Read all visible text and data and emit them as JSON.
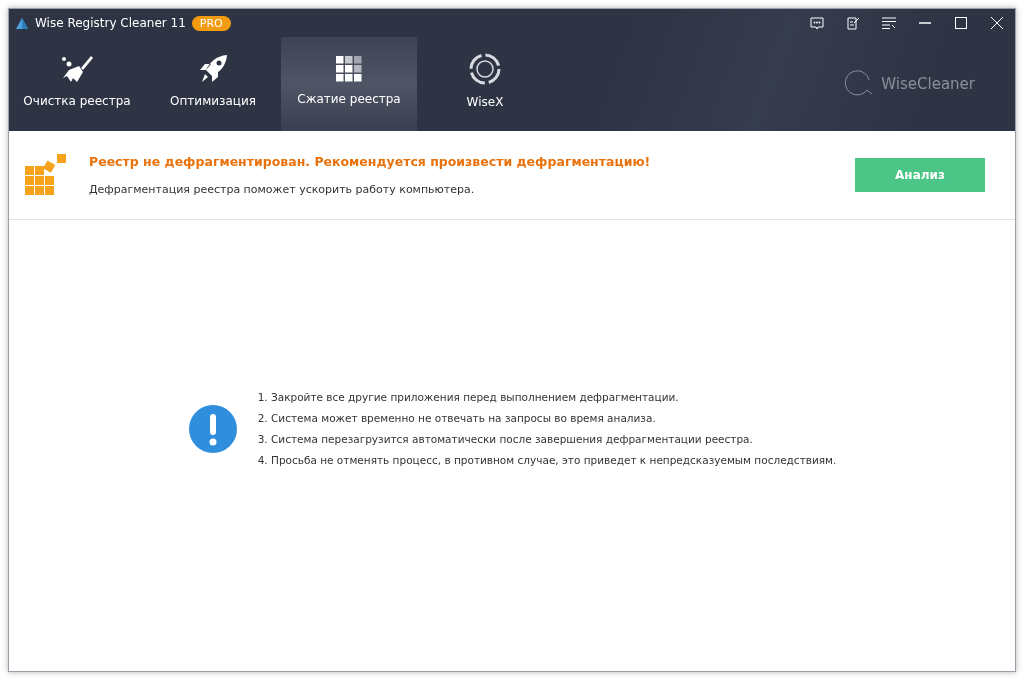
{
  "window": {
    "title": "Wise Registry Cleaner 11",
    "badge": "PRO"
  },
  "tabs": [
    {
      "label": "Очистка реестра",
      "selected": false
    },
    {
      "label": "Оптимизация",
      "selected": false
    },
    {
      "label": "Сжатие реестра",
      "selected": true
    },
    {
      "label": "WiseX",
      "selected": false
    }
  ],
  "brand": "WiseCleaner",
  "banner": {
    "title": "Реестр не дефрагментирован. Рекомендуется произвести дефрагментацию!",
    "subtitle": "Дефрагментация реестра поможет ускорить работу компьютера.",
    "button": "Анализ"
  },
  "notes": [
    "1. Закройте все другие приложения перед выполнением дефрагментации.",
    "2. Система может временно не отвечать на запросы во время анализа.",
    "3. Система перезагрузится автоматически после завершения дефрагментации реестра.",
    "4. Просьба не отменять процесс, в противном случае, это приведет к непредсказуемым последствиям."
  ]
}
